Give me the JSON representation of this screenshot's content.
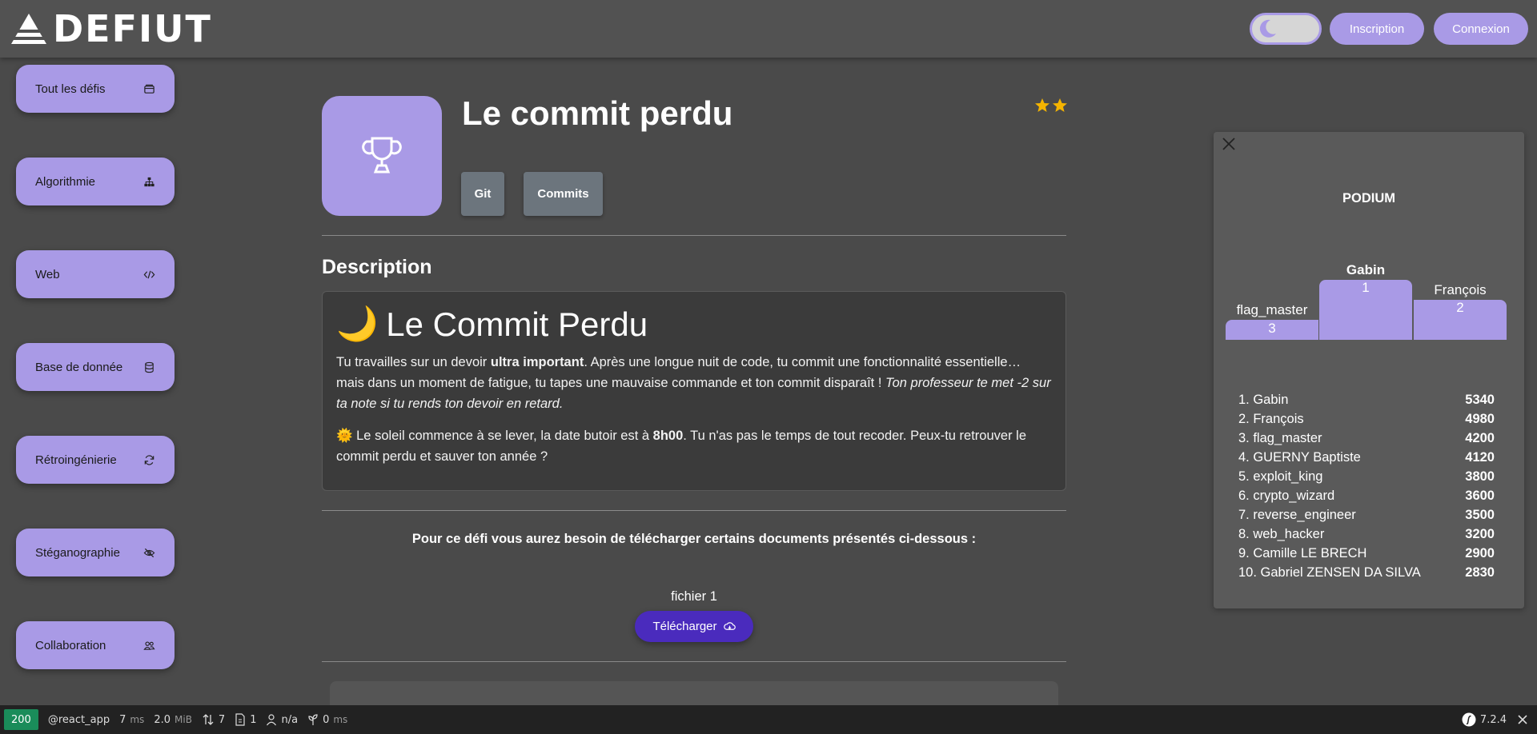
{
  "header": {
    "brand": "DEFIUT",
    "signup_label": "Inscription",
    "login_label": "Connexion"
  },
  "sidebar": {
    "items": [
      {
        "label": "Tout les défis",
        "icon": "wallet-icon"
      },
      {
        "label": "Algorithmie",
        "icon": "hierarchy-icon"
      },
      {
        "label": "Web",
        "icon": "code-icon"
      },
      {
        "label": "Base de donnée",
        "icon": "database-icon"
      },
      {
        "label": "Rétroingénierie",
        "icon": "refresh-icon"
      },
      {
        "label": "Stéganographie",
        "icon": "eye-slash-icon"
      },
      {
        "label": "Collaboration",
        "icon": "users-icon"
      }
    ]
  },
  "challenge": {
    "title": "Le commit perdu",
    "difficulty_stars": 2,
    "tags": [
      "Git",
      "Commits"
    ],
    "description_label": "Description",
    "desc_heading_emoji": "🌙",
    "desc_heading": "Le Commit Perdu",
    "p1_a": "Tu travailles sur un devoir ",
    "p1_bold": "ultra important",
    "p1_b": ". Après une longue nuit de code, tu commit une fonctionnalité essentielle… mais dans un moment de fatigue, tu tapes une mauvaise commande et ton commit disparaît ! ",
    "p1_italic": "Ton professeur te met -2 sur ta note si tu rends ton devoir en retard.",
    "p2_emoji": "🌞",
    "p2_a": " Le soleil commence à se lever, la date butoir est à ",
    "p2_bold": "8h00",
    "p2_b": ". Tu n'as pas le temps de tout recoder. Peux-tu retrouver le commit perdu et sauver ton année ?",
    "need_text": "Pour ce défi vous aurez besoin de télécharger certains documents présentés ci-dessous :",
    "file_label": "fichier 1",
    "download_label": "Télécharger"
  },
  "podium": {
    "title": "PODIUM",
    "first": {
      "name": "Gabin",
      "place": "1"
    },
    "second": {
      "name": "François",
      "place": "2"
    },
    "third": {
      "name": "flag_master",
      "place": "3"
    },
    "ranking": [
      {
        "label": "1. Gabin",
        "score": "5340"
      },
      {
        "label": "2. François",
        "score": "4980"
      },
      {
        "label": "3. flag_master",
        "score": "4200"
      },
      {
        "label": "4. GUERNY Baptiste",
        "score": "4120"
      },
      {
        "label": "5. exploit_king",
        "score": "3800"
      },
      {
        "label": "6. crypto_wizard",
        "score": "3600"
      },
      {
        "label": "7. reverse_engineer",
        "score": "3500"
      },
      {
        "label": "8. web_hacker",
        "score": "3200"
      },
      {
        "label": "9. Camille LE BRECH",
        "score": "2900"
      },
      {
        "label": "10. Gabriel ZENSEN DA SILVA",
        "score": "2830"
      }
    ]
  },
  "debug_bar": {
    "status": "200",
    "route": "@react_app",
    "time": "7",
    "time_unit": "ms",
    "memory": "2.0",
    "memory_unit": "MiB",
    "requests": "7",
    "files": "1",
    "user": "n/a",
    "render": "0",
    "render_unit": "ms",
    "version": "7.2.4"
  },
  "colors": {
    "accent": "#a99ae6",
    "download": "#4a2bbd",
    "tag": "#6c757d",
    "background": "#4a4a4a",
    "star": "#f5b400"
  }
}
